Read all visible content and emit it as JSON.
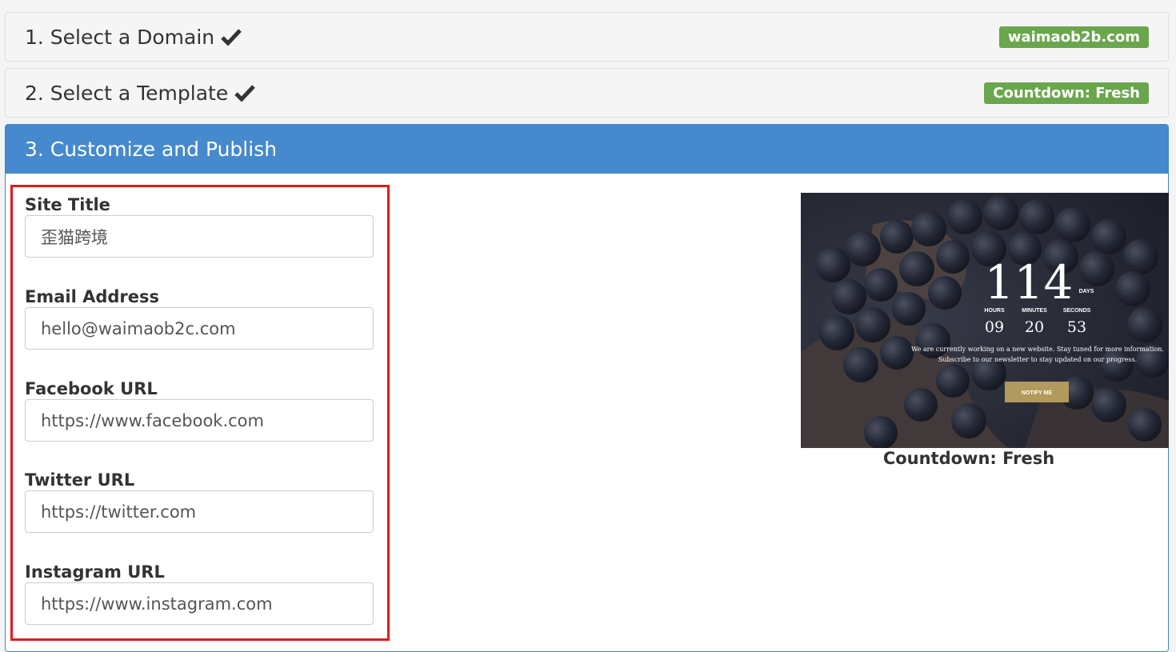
{
  "steps": [
    {
      "title": "1. Select a Domain",
      "badge": "waimaob2b.com"
    },
    {
      "title": "2. Select a Template",
      "badge": "Countdown: Fresh"
    },
    {
      "title": "3. Customize and Publish"
    }
  ],
  "form": {
    "fields": [
      {
        "label": "Site Title",
        "value": "歪猫跨境"
      },
      {
        "label": "Email Address",
        "value": "hello@waimaob2c.com"
      },
      {
        "label": "Facebook URL",
        "value": "https://www.facebook.com"
      },
      {
        "label": "Twitter URL",
        "value": "https://twitter.com"
      },
      {
        "label": "Instagram URL",
        "value": "https://www.instagram.com"
      }
    ]
  },
  "preview": {
    "caption": "Countdown: Fresh",
    "days": "114",
    "days_label": "DAYS",
    "hours_label": "HOURS",
    "minutes_label": "MINUTES",
    "seconds_label": "SECONDS",
    "hours": "09",
    "minutes": "20",
    "seconds": "53",
    "line1": "We are currently working on a new website. Stay tuned for more information.",
    "line2": "Subscribe to our newsletter to stay updated on our progress.",
    "button": "NOTIFY ME",
    "accent": "#b19a5b"
  },
  "colors": {
    "badge": "#6aa64c",
    "active_header": "#4689cc",
    "highlight_border": "#e3191c"
  }
}
